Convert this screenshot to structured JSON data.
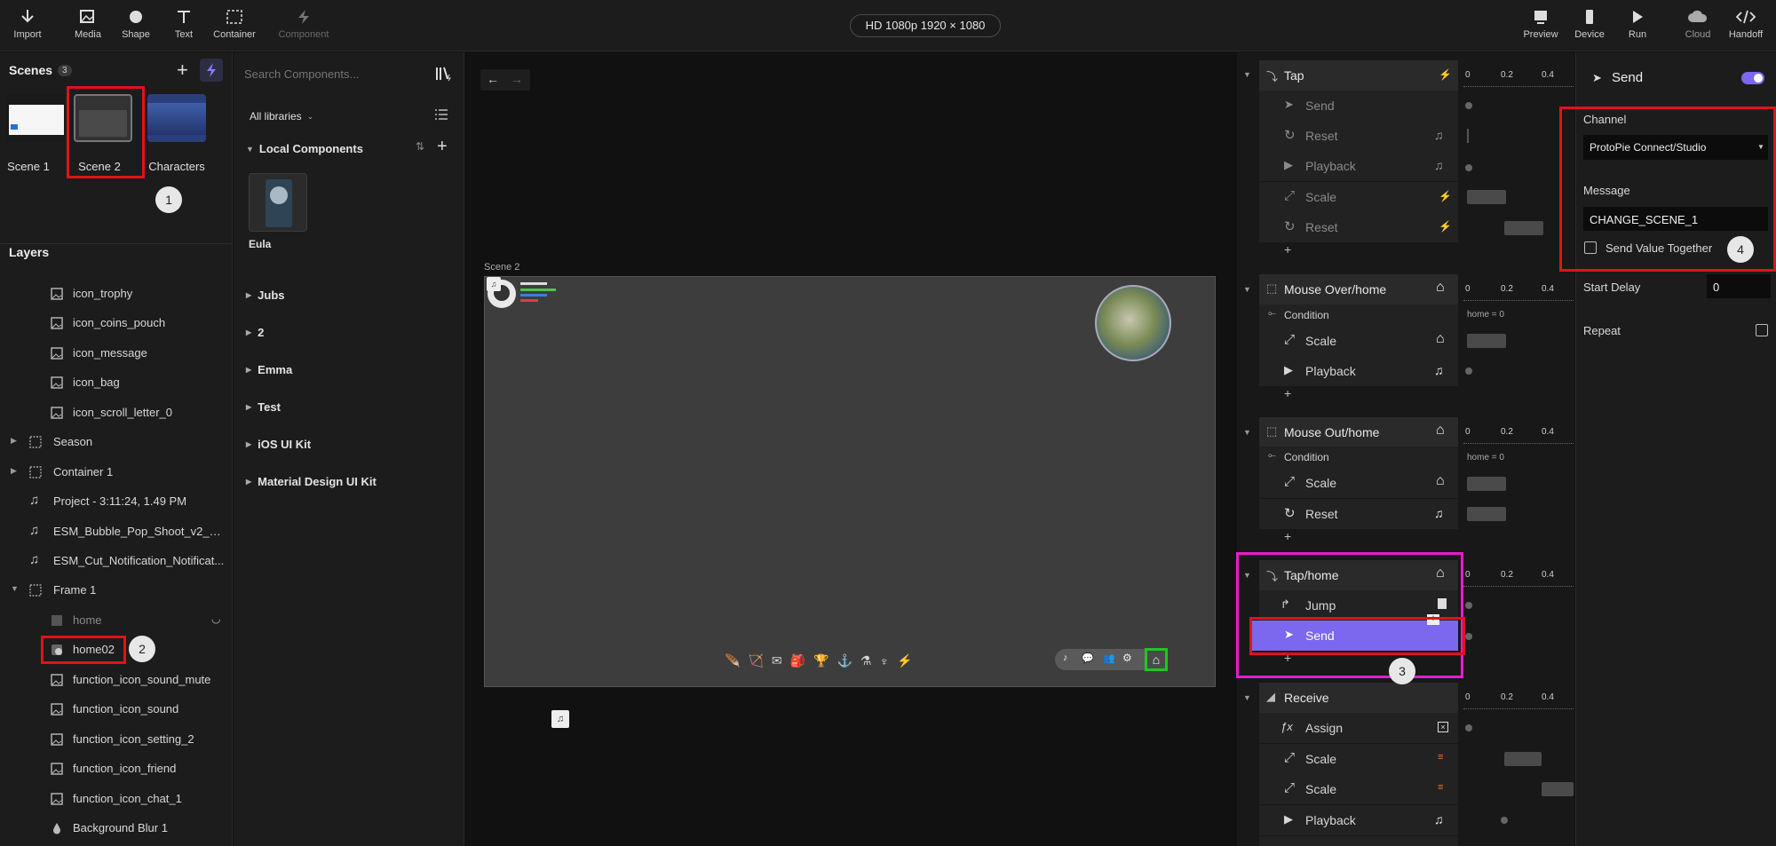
{
  "toolbar": {
    "left_tools": [
      {
        "label": "Import",
        "icon": "import-icon"
      },
      {
        "label": "Media",
        "icon": "media-icon"
      },
      {
        "label": "Shape",
        "icon": "shape-icon"
      },
      {
        "label": "Text",
        "icon": "text-icon"
      },
      {
        "label": "Container",
        "icon": "container-icon"
      },
      {
        "label": "Component",
        "icon": "component-icon"
      }
    ],
    "device": "HD 1080p  1920 × 1080",
    "right_tools": [
      {
        "label": "Preview",
        "icon": "preview-icon"
      },
      {
        "label": "Device",
        "icon": "device-icon"
      },
      {
        "label": "Run",
        "icon": "run-icon"
      },
      {
        "label": "Cloud",
        "icon": "cloud-icon"
      },
      {
        "label": "Handoff",
        "icon": "handoff-icon"
      }
    ]
  },
  "scenes": {
    "title": "Scenes",
    "count": "3",
    "items": [
      "Scene 1",
      "Scene 2",
      "Characters"
    ]
  },
  "layers": {
    "title": "Layers",
    "items": [
      {
        "label": "icon_trophy",
        "icon": "image-icon"
      },
      {
        "label": "icon_coins_pouch",
        "icon": "image-icon"
      },
      {
        "label": "icon_message",
        "icon": "image-icon"
      },
      {
        "label": "icon_bag",
        "icon": "image-icon"
      },
      {
        "label": "icon_scroll_letter_0",
        "icon": "image-icon"
      },
      {
        "label": "Season",
        "icon": "container-icon"
      },
      {
        "label": "Container 1",
        "icon": "container-icon"
      },
      {
        "label": "Project - 3:11:24, 1.49 PM",
        "icon": "music-icon"
      },
      {
        "label": "ESM_Bubble_Pop_Shoot_v2_Ga...",
        "icon": "music-icon"
      },
      {
        "label": "ESM_Cut_Notification_Notificat...",
        "icon": "music-icon"
      },
      {
        "label": "Frame 1",
        "icon": "container-icon"
      },
      {
        "label": "home",
        "icon": "image-icon"
      },
      {
        "label": "home02",
        "icon": "component-instance-icon"
      },
      {
        "label": "function_icon_sound_mute",
        "icon": "image-icon"
      },
      {
        "label": "function_icon_sound",
        "icon": "image-icon"
      },
      {
        "label": "function_icon_setting_2",
        "icon": "image-icon"
      },
      {
        "label": "function_icon_friend",
        "icon": "image-icon"
      },
      {
        "label": "function_icon_chat_1",
        "icon": "image-icon"
      },
      {
        "label": "Background Blur 1",
        "icon": "drop-icon"
      }
    ]
  },
  "components": {
    "search_placeholder": "Search Components...",
    "library_select": "All libraries",
    "local_title": "Local Components",
    "local_item": "Eula",
    "libraries": [
      "Jubs",
      "2",
      "Emma",
      "Test",
      "iOS UI Kit",
      "Material Design UI Kit"
    ]
  },
  "canvas": {
    "scene_label": "Scene 2"
  },
  "timeline": {
    "ruler": [
      "0",
      "0.2",
      "0.4"
    ],
    "groups": [
      {
        "trigger": "Tap",
        "items": [
          "Send",
          "Reset",
          "Playback",
          "Scale",
          "Reset"
        ]
      },
      {
        "trigger": "Mouse Over/home",
        "condition": "Condition",
        "cond_value": "home = 0",
        "items": [
          "Scale",
          "Playback"
        ]
      },
      {
        "trigger": "Mouse Out/home",
        "condition": "Condition",
        "cond_value": "home = 0",
        "items": [
          "Scale",
          "Reset"
        ]
      },
      {
        "trigger": "Tap/home",
        "items": [
          "Jump",
          "Send"
        ]
      },
      {
        "trigger": "Receive",
        "items": [
          "Assign",
          "Scale",
          "Scale",
          "Playback"
        ]
      }
    ],
    "plus": "+"
  },
  "properties": {
    "title": "Send",
    "channel_label": "Channel",
    "channel_value": "ProtoPie Connect/Studio",
    "message_label": "Message",
    "message_value": "CHANGE_SCENE_1",
    "send_value_label": "Send Value Together",
    "start_delay_label": "Start Delay",
    "start_delay_value": "0",
    "repeat_label": "Repeat"
  },
  "annotations": [
    "1",
    "2",
    "3",
    "4"
  ],
  "colors": {
    "accent": "#7b68ee",
    "annotation_red": "#e0121a",
    "annotation_magenta": "#e81cc8",
    "highlight_green": "#22c522"
  }
}
